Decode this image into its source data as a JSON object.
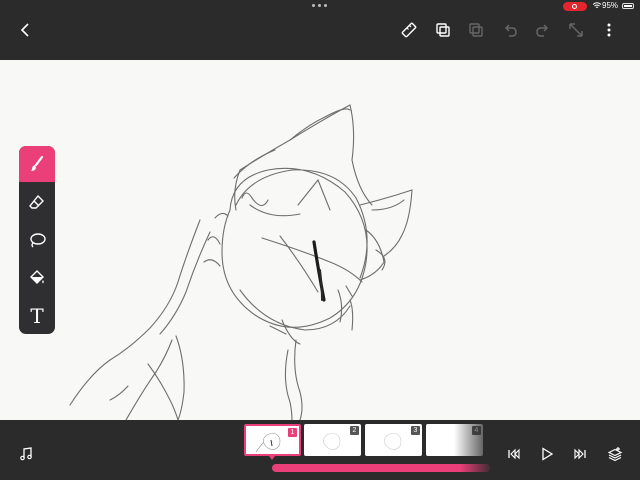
{
  "status_bar": {
    "battery_percent": "95%",
    "recording": true,
    "icons": [
      "multitask-dots-icon",
      "screen-record-icon",
      "wifi-icon",
      "battery-icon"
    ]
  },
  "top_bar": {
    "back_icon": "chevron-left-icon",
    "actions": [
      {
        "name": "ruler-icon",
        "enabled": true
      },
      {
        "name": "layers-copy-icon",
        "enabled": true
      },
      {
        "name": "layers-paste-icon",
        "enabled": false
      },
      {
        "name": "undo-icon",
        "enabled": false
      },
      {
        "name": "redo-icon",
        "enabled": false
      },
      {
        "name": "expand-icon",
        "enabled": false
      },
      {
        "name": "more-vertical-icon",
        "enabled": true
      }
    ]
  },
  "tools": [
    {
      "name": "brush-tool",
      "icon": "brush-icon",
      "active": true
    },
    {
      "name": "eraser-tool",
      "icon": "eraser-icon",
      "active": false
    },
    {
      "name": "lasso-tool",
      "icon": "lasso-icon",
      "active": false
    },
    {
      "name": "fill-tool",
      "icon": "paint-bucket-icon",
      "active": false
    },
    {
      "name": "text-tool",
      "icon": "text-icon",
      "label": "T",
      "active": false
    }
  ],
  "frames": [
    {
      "number": "1",
      "active": true
    },
    {
      "number": "2",
      "active": false
    },
    {
      "number": "3",
      "active": false
    },
    {
      "number": "4",
      "active": false
    }
  ],
  "bottom_bar": {
    "sound_icon": "music-note-icon",
    "controls": [
      "skip-back-icon",
      "play-icon",
      "skip-forward-icon",
      "add-frame-icon"
    ]
  },
  "colors": {
    "accent": "#ea3f78",
    "bar_background": "#2b2b2b",
    "canvas_background": "#f8f8f6",
    "recording": "#e5252d"
  }
}
